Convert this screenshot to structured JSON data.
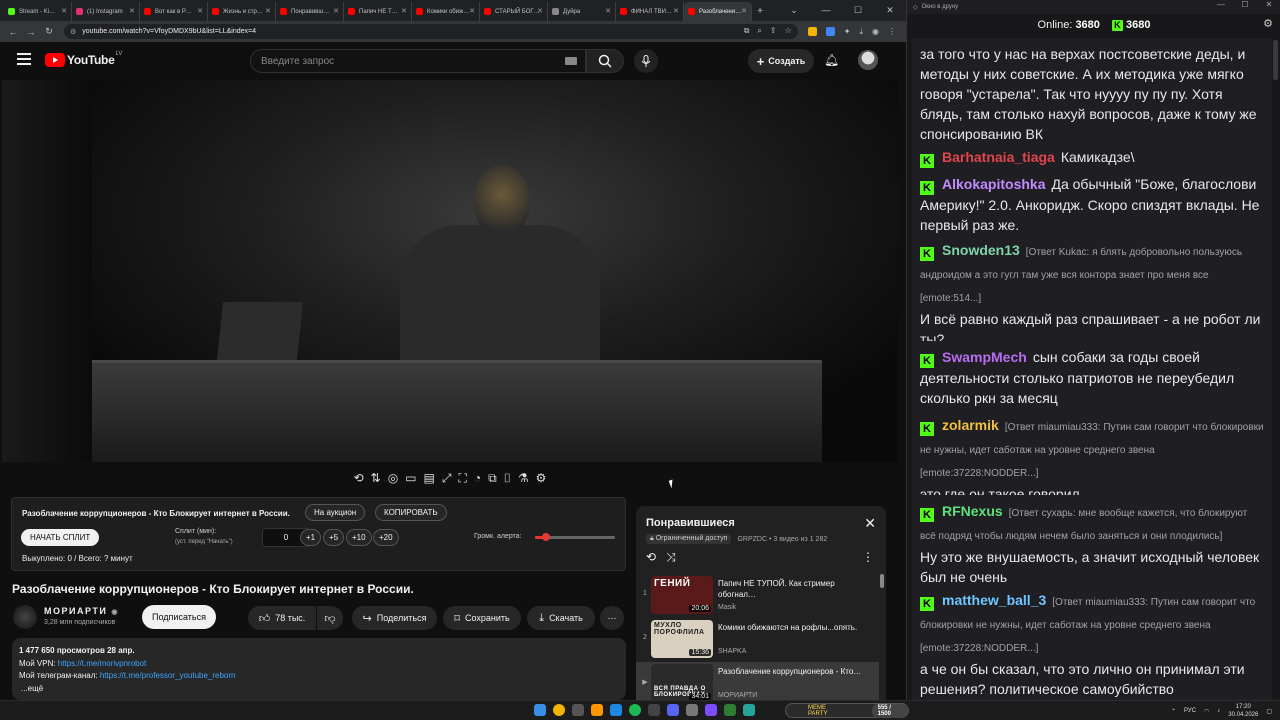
{
  "browser": {
    "tabs": [
      {
        "label": "Stream - Ki…",
        "color": "#53fc18"
      },
      {
        "label": "(1) Instagram",
        "color": "#e1306c"
      },
      {
        "label": "Вот как в Р…",
        "color": "#ff0000"
      },
      {
        "label": "Жизнь и стр…",
        "color": "#ff0000"
      },
      {
        "label": "Понравивш…",
        "color": "#ff0000"
      },
      {
        "label": "Папич НЕ Т…",
        "color": "#ff0000"
      },
      {
        "label": "Комики обиж…",
        "color": "#ff0000"
      },
      {
        "label": "СТАРЫЙ БОГ…",
        "color": "#ff0000"
      },
      {
        "label": "Дуйра",
        "color": "#888888"
      },
      {
        "label": "ФИНАЛ ТВИ…",
        "color": "#ff0000"
      },
      {
        "label": "Разоблачени…",
        "color": "#ff0000",
        "active": true
      }
    ],
    "url": "youtube.com/watch?v=VfoyDMDX9bU&list=LL&index=4"
  },
  "youtube": {
    "logo_text": "YouTube",
    "logo_region": "LV",
    "search_placeholder": "Введите запрос",
    "create_label": "Создать"
  },
  "split": {
    "title": "Разоблачение коррупционеров - Кто Блокирует интернет в России.",
    "auction_label": "На аукцион",
    "copy_label": "КОПИРОВАТЬ",
    "start_label": "НАЧАТЬ СПЛИТ",
    "split_min_label": "Сплит (мин):",
    "split_hint": "(уст. перед \"Начать\")",
    "split_value": "0",
    "increments": [
      "+1",
      "+5",
      "+10",
      "+20"
    ],
    "volume_label": "Громк. алерта:",
    "volume_level": 0.14,
    "bought_text": "Выкуплено: 0 / Всего: ? минут"
  },
  "video": {
    "title": "Разоблачение коррупционеров - Кто Блокирует интернет в России.",
    "channel": "МОРИАРТИ",
    "subscribers": "3,28 млн подписчиков",
    "subscribe_label": "Подписаться",
    "likes": "78 тыс.",
    "share_label": "Поделиться",
    "save_label": "Сохранить",
    "download_label": "Скачать",
    "views_line": "1 477 650 просмотров  28 апр.",
    "vpn_label": "Мой VPN: ",
    "vpn_link": "https://t.me/morivpnrobot",
    "tg_label": "Мой телеграм-канал: ",
    "tg_link": "https://t.me/professor_youtube_reborn",
    "more_label": "...ещё"
  },
  "playlist": {
    "title": "Понравившиеся",
    "access": "Ограниченный доступ",
    "meta": "GRPZDC • 3 видео из 1 282",
    "items": [
      {
        "num": "1",
        "title": "Папич НЕ ТУПОЙ. Как стример обогнал…",
        "channel": "Masik",
        "duration": "20:06",
        "thumb_text": "ГЕНИЙ",
        "thumb_color": "#5a1a1a"
      },
      {
        "num": "2",
        "title": "Комики обижаются на рофлы...опять.",
        "channel": "SHAPKA",
        "duration": "15:36",
        "thumb_text": "МУХЛО ПОРОФЛИЛА",
        "thumb_color": "#d9d0c0"
      },
      {
        "num": "▶",
        "title": "Разоблачение коррупционеров - Кто…",
        "channel": "МОРИАРТИ",
        "duration": "34:01",
        "thumb_text": "ВСЯ ПРАВДА О БЛОКИРОВКАХ",
        "thumb_color": "#2a2a2a"
      }
    ]
  },
  "chat": {
    "window_title": "Окно в друну",
    "online_label": "Online:",
    "online_count": "3680",
    "kick_count": "3680",
    "messages": [
      {
        "user": "",
        "color": "#ffffff",
        "reply": "",
        "text": "за того что у нас на верхах постсоветские деды, и методы у них советские. А их методика уже мягко говоря \"устарела\". Так что нуууу пу пу пу. Хотя блядь, там столько нахуй вопросов, даже к тому же спонсированию ВК"
      },
      {
        "user": "Barhatnaia_tiaga",
        "color": "#e0454b",
        "reply": "",
        "text": "Камикадзе\\"
      },
      {
        "user": "Alkokapitoshka",
        "color": "#c18cff",
        "reply": "",
        "text": "Да обычный \"Боже, благослови Америку!\" 2.0. Анкоридж. Скоро спиздят вклады. Не первый раз же."
      },
      {
        "user": "Snowden13",
        "color": "#7fd4a8",
        "reply": "[Ответ Kukac: я блять добровольно пользуюсь андроидом а это гугл там уже вся контора знает про меня все [emote:514...]",
        "text": "И всё равно каждый раз спрашивает - а не робот ли ты?"
      },
      {
        "user": "SwampMech",
        "color": "#b86cf0",
        "reply": "",
        "text": "сын собаки за годы своей деятельности столько патриотов не переубедил сколько ркн за месяц"
      },
      {
        "user": "zolarmik",
        "color": "#f0c040",
        "reply": "[Ответ miaumiau333: Путин сам говорит что блокировки не нужны, идет саботаж на уровне среднего звена [emote:37228:NODDER...]",
        "text": "это где он такое говорил"
      },
      {
        "user": "RFNexus",
        "color": "#5ee07a",
        "reply": "[Ответ сухарь: мне вообще кажется, что блокируют всё подряд чтобы людям нечем было заняться и они плодились]",
        "text": "Ну это же внушаемость, а значит исходный человек был не очень"
      },
      {
        "user": "matthew_ball_3",
        "color": "#6ec6ff",
        "reply": "[Ответ miaumiau333: Путин сам говорит что блокировки не нужны, идет саботаж на уровне среднего звена [emote:37228:NODDER...]",
        "text": "а че он бы сказал, что это лично он принимал эти решения? политическое самоубийство"
      }
    ]
  },
  "taskbar": {
    "meme_label": "MEME PARTY",
    "meme_counter": "555 / 1500",
    "lang": "РУС",
    "time": "17:20",
    "date": "30.04.2026"
  }
}
